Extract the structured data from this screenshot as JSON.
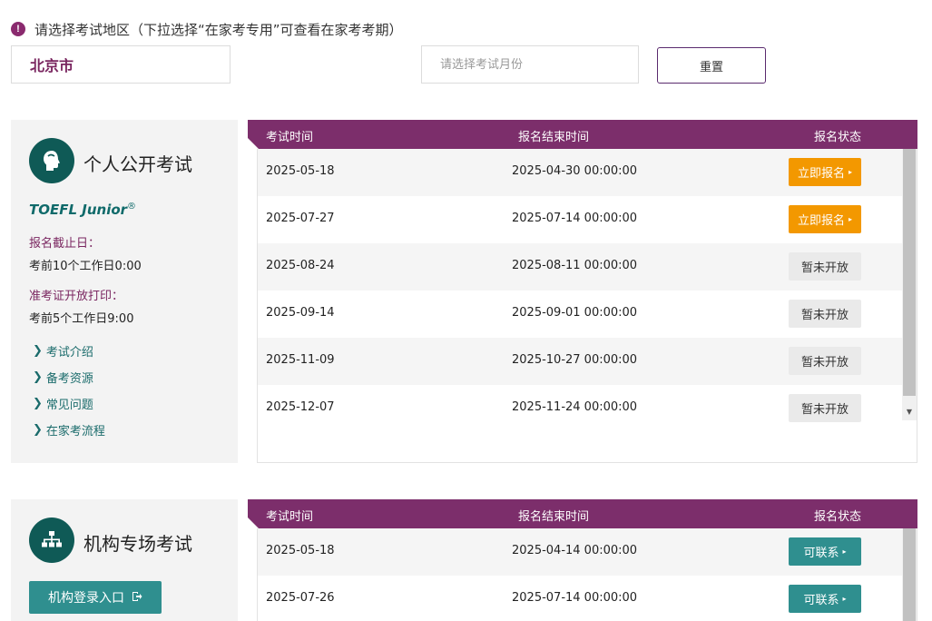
{
  "notice": {
    "icon": "exclamation-icon",
    "text": "请选择考试地区（下拉选择“在家考专用”可查看在家考考期）"
  },
  "filters": {
    "region_value": "北京市",
    "month_placeholder": "请选择考试月份",
    "reset_label": "重置"
  },
  "colors": {
    "brand_purple": "#7c2e6b",
    "teal": "#2f8f8f",
    "dark_teal": "#0f5a56",
    "orange": "#f39800"
  },
  "public_exam": {
    "icon": "head-profile-icon",
    "title": "个人公开考试",
    "brand": "TOEFL Junior",
    "brand_mark": "®",
    "deadline_label": "报名截止日：",
    "deadline_value": "考前10个工作日0:00",
    "admission_label": "准考证开放打印：",
    "admission_value": "考前5个工作日9:00",
    "links": [
      {
        "label": "考试介绍"
      },
      {
        "label": "备考资源"
      },
      {
        "label": "常见问题"
      },
      {
        "label": "在家考流程"
      }
    ]
  },
  "org_exam": {
    "icon": "org-chart-icon",
    "title": "机构专场考试",
    "login_label": "机构登录入口",
    "login_icon": "sign-in-icon"
  },
  "table_headers": {
    "date": "考试时间",
    "end": "报名结束时间",
    "status": "报名状态"
  },
  "public_rows": [
    {
      "date": "2025-05-18",
      "end": "2025-04-30 00:00:00",
      "status": "立即报名",
      "arrow": "▸"
    },
    {
      "date": "2025-07-27",
      "end": "2025-07-14 00:00:00",
      "status": "立即报名",
      "arrow": "▸"
    },
    {
      "date": "2025-08-24",
      "end": "2025-08-11 00:00:00",
      "status": "暂未开放",
      "arrow": ""
    },
    {
      "date": "2025-09-14",
      "end": "2025-09-01 00:00:00",
      "status": "暂未开放",
      "arrow": ""
    },
    {
      "date": "2025-11-09",
      "end": "2025-10-27 00:00:00",
      "status": "暂未开放",
      "arrow": ""
    },
    {
      "date": "2025-12-07",
      "end": "2025-11-24 00:00:00",
      "status": "暂未开放",
      "arrow": ""
    }
  ],
  "org_rows": [
    {
      "date": "2025-05-18",
      "end": "2025-04-14 00:00:00",
      "status": "可联系",
      "arrow": "▸"
    },
    {
      "date": "2025-07-26",
      "end": "2025-07-14 00:00:00",
      "status": "可联系",
      "arrow": "▸"
    }
  ]
}
